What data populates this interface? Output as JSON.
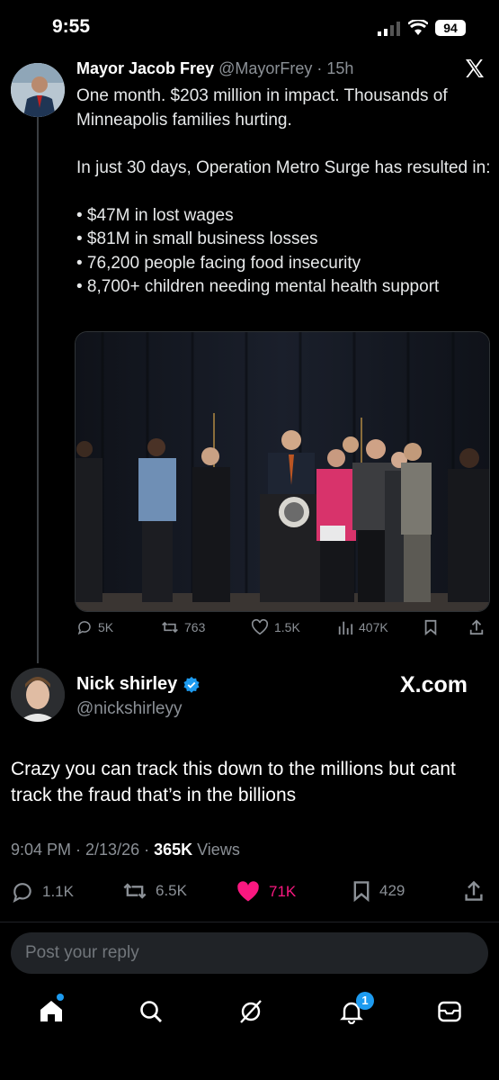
{
  "status_bar": {
    "time": "9:55",
    "battery": "94"
  },
  "quoted_tweet": {
    "author_name": "Mayor Jacob Frey",
    "handle": "@MayorFrey",
    "separator": "·",
    "age": "15h",
    "text_lines": [
      "One month. $203 million in impact. Thousands of Minneapolis families hurting.",
      "",
      "In just 30 days, Operation Metro Surge has resulted in:",
      "",
      "• $47M in lost wages",
      "• $81M in small business losses",
      "• 76,200 people facing food insecurity",
      "• 8,700+ children needing mental health support"
    ],
    "actions": {
      "replies": "5K",
      "reposts": "763",
      "likes": "1.5K",
      "views": "407K"
    }
  },
  "tweet": {
    "author_name": "Nick shirley",
    "handle": "@nickshirleyy",
    "watermark": "X.com",
    "text": "Crazy you can track this down to the millions but cant track the fraud that’s in the billions",
    "meta": {
      "time_date": "9:04 PM · 2/13/26 · ",
      "views_count": "365K",
      "views_label": " Views"
    },
    "actions": {
      "replies": "1.1K",
      "reposts": "6.5K",
      "likes": "71K",
      "bookmarks": "429"
    },
    "colors": {
      "like_active": "#f91880",
      "verified": "#1d9bf0"
    }
  },
  "reply": {
    "placeholder": "Post your reply"
  },
  "bottom_nav": {
    "items": [
      "home-icon",
      "search-icon",
      "grok-icon",
      "notifications-icon",
      "messages-icon"
    ],
    "notifications_badge": "1"
  }
}
